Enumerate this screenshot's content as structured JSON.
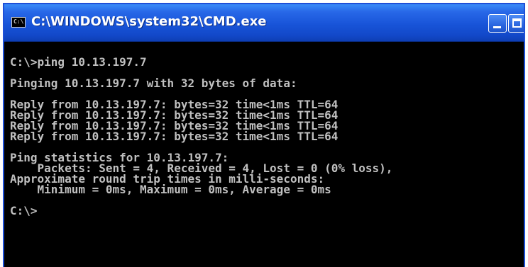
{
  "window": {
    "title": "C:\\WINDOWS\\system32\\CMD.exe",
    "icon_text": "C:\\",
    "icon": "console-icon",
    "controls": {
      "minimize_icon": "minimize-icon",
      "maximize_icon": "maximize-icon"
    },
    "colors": {
      "titlebar": "#1854d8",
      "console_bg": "#000000",
      "console_text": "#c0c0c0"
    }
  },
  "console": {
    "lines": [
      "",
      "C:\\>ping 10.13.197.7",
      "",
      "Pinging 10.13.197.7 with 32 bytes of data:",
      "",
      "Reply from 10.13.197.7: bytes=32 time<1ms TTL=64",
      "Reply from 10.13.197.7: bytes=32 time<1ms TTL=64",
      "Reply from 10.13.197.7: bytes=32 time<1ms TTL=64",
      "Reply from 10.13.197.7: bytes=32 time<1ms TTL=64",
      "",
      "Ping statistics for 10.13.197.7:",
      "    Packets: Sent = 4, Received = 4, Lost = 0 (0% loss),",
      "Approximate round trip times in milli-seconds:",
      "    Minimum = 0ms, Maximum = 0ms, Average = 0ms",
      "",
      "C:\\>"
    ]
  }
}
